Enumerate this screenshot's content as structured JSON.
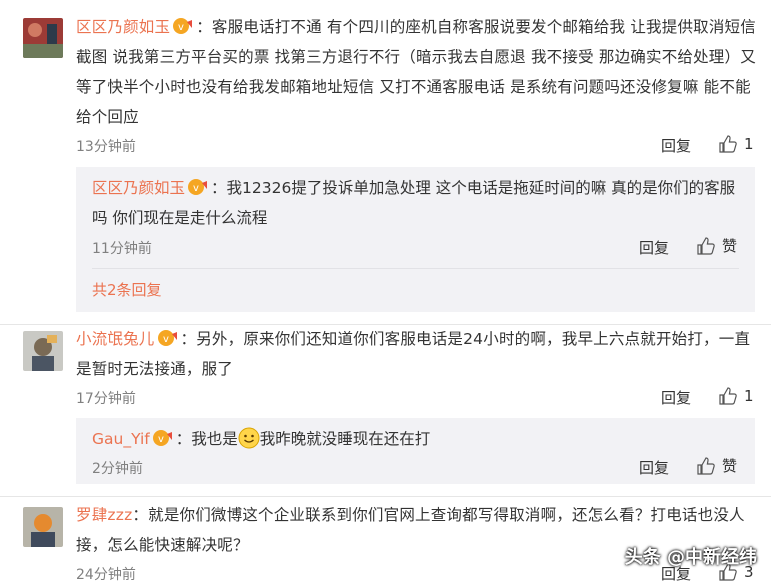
{
  "comments": [
    {
      "user": "区区乃颜如玉",
      "text": "：客服电话打不通 有个四川的座机自称客服说要发个邮箱给我 让我提供取消短信截图 说我第三方平台买的票 找第三方退行不行（暗示我去自愿退 我不接受 那边确实不给处理）又等了快半个小时也没有给我发邮箱地址短信 又打不通客服电话 是系统有问题吗还没修复嘛 能不能给个回应",
      "time": "13分钟前",
      "reply_label": "回复",
      "likes": "1",
      "reply": {
        "user": "区区乃颜如玉",
        "text": "：我12326提了投诉单加急处理 这个电话是拖延时间的嘛 真的是你们的客服吗 你们现在是走什么流程",
        "time": "11分钟前",
        "reply_label": "回复",
        "like_label": "赞"
      },
      "more_replies": "共2条回复"
    },
    {
      "user": "小流氓兔儿",
      "text": "：另外，原来你们还知道你们客服电话是24小时的啊，我早上六点就开始打，一直是暂时无法接通，服了",
      "time": "17分钟前",
      "reply_label": "回复",
      "likes": "1",
      "reply": {
        "user": "Gau_Yif",
        "text_before": "：我也是",
        "text_after": "我昨晚就没睡现在还在打",
        "time": "2分钟前",
        "reply_label": "回复",
        "like_label": "赞"
      }
    },
    {
      "user": "罗肆zzz",
      "text": "：就是你们微博这个企业联系到你们官网上查询都写得取消啊，还怎么看？打电话也没人接，怎么能快速解决呢？",
      "time": "24分钟前",
      "reply_label": "回复",
      "likes": "3"
    }
  ],
  "watermark": "头条 @中新经纬",
  "colors": {
    "username": "#eb7350",
    "reply_bg": "#f2f2f5",
    "meta": "#808080"
  },
  "icons": [
    "avatar",
    "vip-badge-icon",
    "thumb-up-icon",
    "smile-emoji-icon"
  ]
}
